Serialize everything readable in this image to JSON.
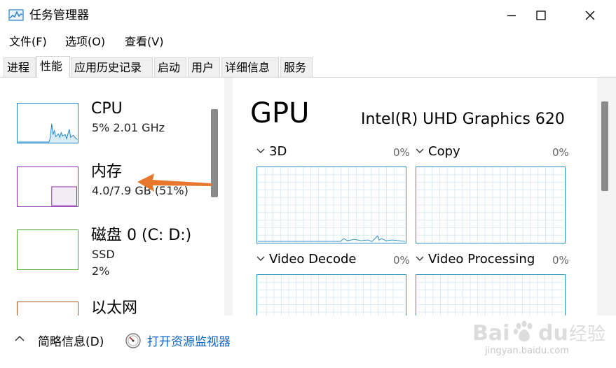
{
  "window": {
    "title": "任务管理器",
    "icon": "task-manager-icon",
    "controls": [
      "minimize-icon",
      "maximize-icon",
      "close-icon"
    ]
  },
  "menu": {
    "file": "文件(F)",
    "options": "选项(O)",
    "view": "查看(V)"
  },
  "tabs": [
    {
      "label": "进程",
      "active": false
    },
    {
      "label": "性能",
      "active": true
    },
    {
      "label": "应用历史记录",
      "active": false
    },
    {
      "label": "启动",
      "active": false
    },
    {
      "label": "用户",
      "active": false
    },
    {
      "label": "详细信息",
      "active": false
    },
    {
      "label": "服务",
      "active": false
    }
  ],
  "resources": [
    {
      "name": "CPU",
      "line1": "5%  2.01 GHz",
      "line2": "",
      "color": "#1b86c8"
    },
    {
      "name": "内存",
      "line1": "4.0/7.9 GB (51%)",
      "line2": "",
      "color": "#8e2cb3"
    },
    {
      "name": "磁盘 0 (C: D:)",
      "line1": "SSD",
      "line2": "2%",
      "color": "#4da830"
    },
    {
      "name": "以太网",
      "line1": "",
      "line2": "",
      "color": "#a8541a"
    }
  ],
  "gpu": {
    "heading": "GPU",
    "model": "Intel(R) UHD Graphics 620",
    "engines": [
      {
        "label": "3D",
        "percent": "0%"
      },
      {
        "label": "Copy",
        "percent": "0%"
      },
      {
        "label": "Video Decode",
        "percent": "0%"
      },
      {
        "label": "Video Processing",
        "percent": "0%"
      }
    ]
  },
  "footer": {
    "brief": "简略信息(D)",
    "open_monitor": "打开资源监视器"
  },
  "watermark": {
    "brand": "Baidu经验",
    "url": "jingyan.baidu.com"
  },
  "colors": {
    "accent_link": "#0b63c4",
    "gpu_graph": "#2f8ec8",
    "annotation_arrow": "#e8772e"
  }
}
